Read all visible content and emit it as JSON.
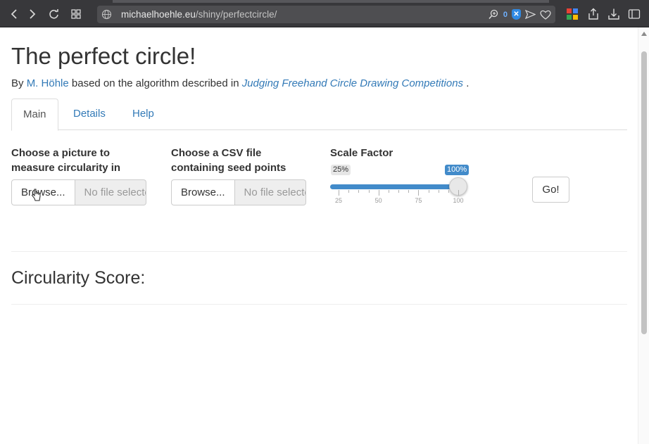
{
  "browser": {
    "url_host": "michaelhoehle.eu",
    "url_path": "/shiny/perfectcircle/",
    "blocked_count": "0"
  },
  "page": {
    "title": "The perfect circle!",
    "byline_prefix": "By",
    "author": "M. Höhle",
    "byline_middle": "based on the algorithm described in",
    "paper_link": "Judging Freehand Circle Drawing Competitions",
    "byline_end": "."
  },
  "tabs": [
    {
      "label": "Main",
      "active": true
    },
    {
      "label": "Details",
      "active": false
    },
    {
      "label": "Help",
      "active": false
    }
  ],
  "inputs": {
    "picture": {
      "label": "Choose a picture to measure circularity in",
      "label_line1": "Choose a picture to",
      "label_line2": "measure circularity in",
      "browse_label": "Browse...",
      "filename_placeholder": "No file selected"
    },
    "csv": {
      "label": "Choose a CSV file containing seed points",
      "label_line1": "Choose a CSV file",
      "label_line2": "containing seed points",
      "browse_label": "Browse...",
      "filename_placeholder": "No file selected"
    },
    "scale": {
      "label": "Scale Factor",
      "min_badge": "25%",
      "value_badge": "100%",
      "min": 25,
      "max": 100,
      "value": 100,
      "ticks": [
        "25",
        "50",
        "75",
        "100"
      ]
    },
    "go_label": "Go!"
  },
  "output": {
    "score_heading": "Circularity Score:"
  },
  "colors": {
    "link": "#337ab7",
    "slider_fill": "#428bca",
    "chrome_bg": "#38383b"
  }
}
